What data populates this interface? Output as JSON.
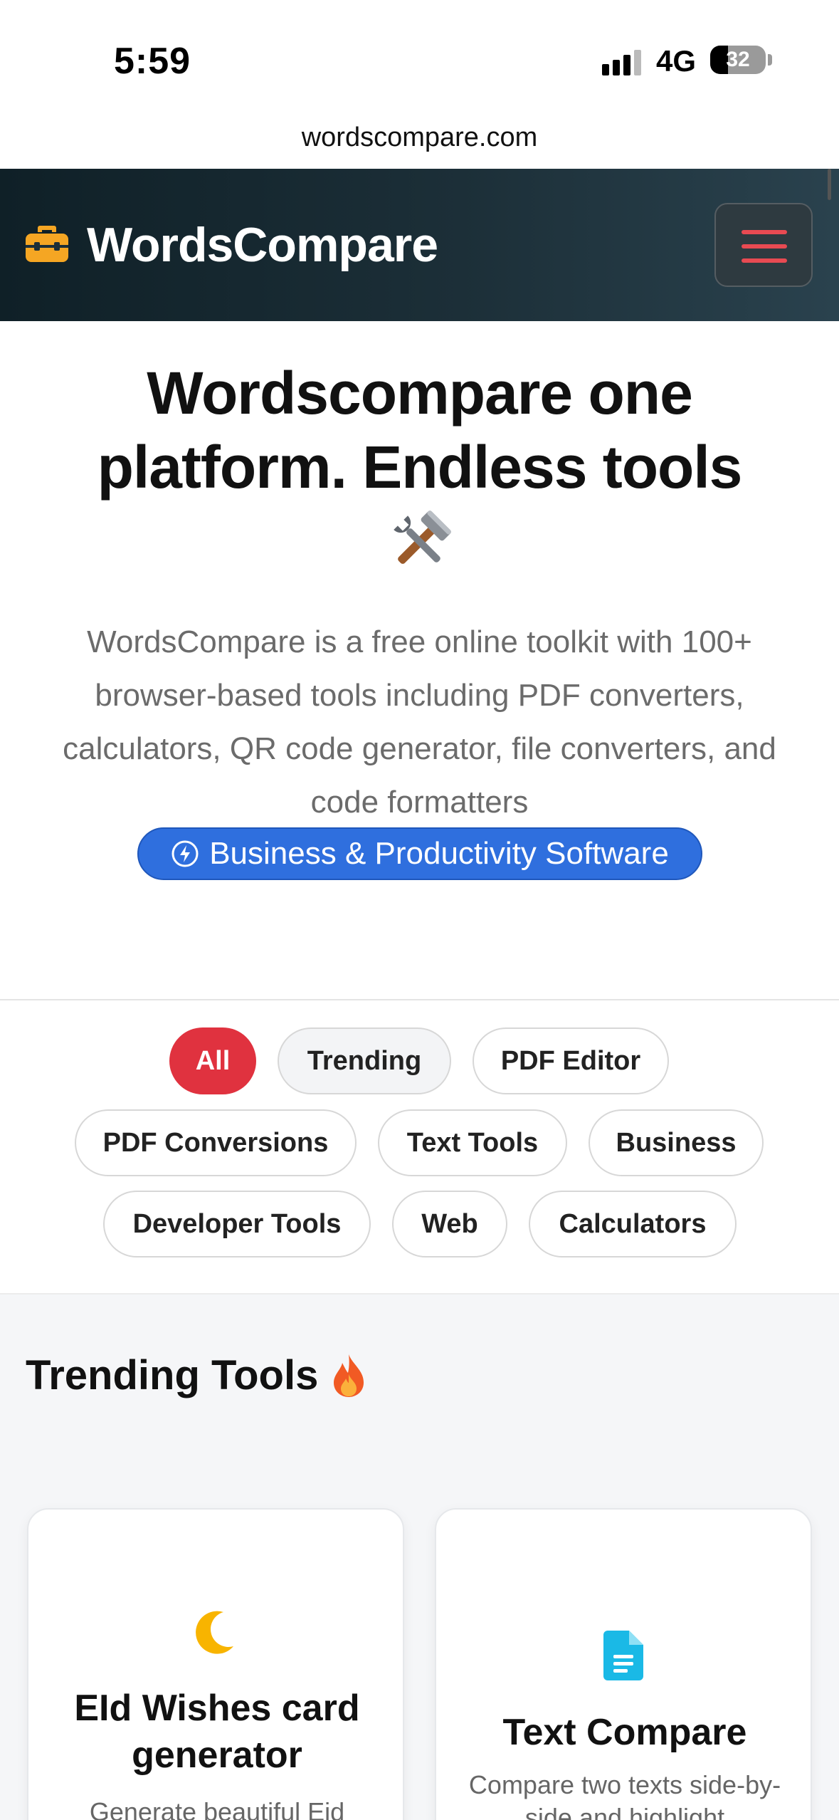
{
  "status_bar": {
    "time": "5:59",
    "network": "4G",
    "battery": "32"
  },
  "browser": {
    "url": "wordscompare.com"
  },
  "navbar": {
    "brand": "WordsCompare",
    "brand_icon": "toolbox-icon",
    "menu_icon": "hamburger-menu-icon"
  },
  "hero": {
    "title": "Wordscompare one platform. Endless tools",
    "title_emoji": "hammer-and-wrench-icon",
    "subtitle": "WordsCompare is a free online toolkit with 100+ browser-based tools including PDF converters, calculators, QR code generator, file converters, and code formatters",
    "badge": "Business & Productivity Software"
  },
  "filters": [
    {
      "label": "All",
      "state": "active"
    },
    {
      "label": "Trending",
      "state": "soft"
    },
    {
      "label": "PDF Editor",
      "state": "normal"
    },
    {
      "label": "PDF Conversions",
      "state": "normal"
    },
    {
      "label": "Text Tools",
      "state": "normal"
    },
    {
      "label": "Business",
      "state": "normal"
    },
    {
      "label": "Developer Tools",
      "state": "normal"
    },
    {
      "label": "Web",
      "state": "normal"
    },
    {
      "label": "Calculators",
      "state": "normal"
    }
  ],
  "trending": {
    "title": "Trending Tools",
    "title_icon": "fire-icon",
    "cards": [
      {
        "icon": "crescent-moon-icon",
        "title": "EId Wishes card generator",
        "desc": "Generate beautiful Eid"
      },
      {
        "icon": "document-icon",
        "title": "Text Compare",
        "desc": "Compare two texts side-by-side and highlight"
      }
    ]
  },
  "colors": {
    "nav_bg": "#0f2027",
    "accent_red": "#e0323f",
    "badge_blue": "#2f6fde",
    "brand_yellow": "#f5a623"
  }
}
